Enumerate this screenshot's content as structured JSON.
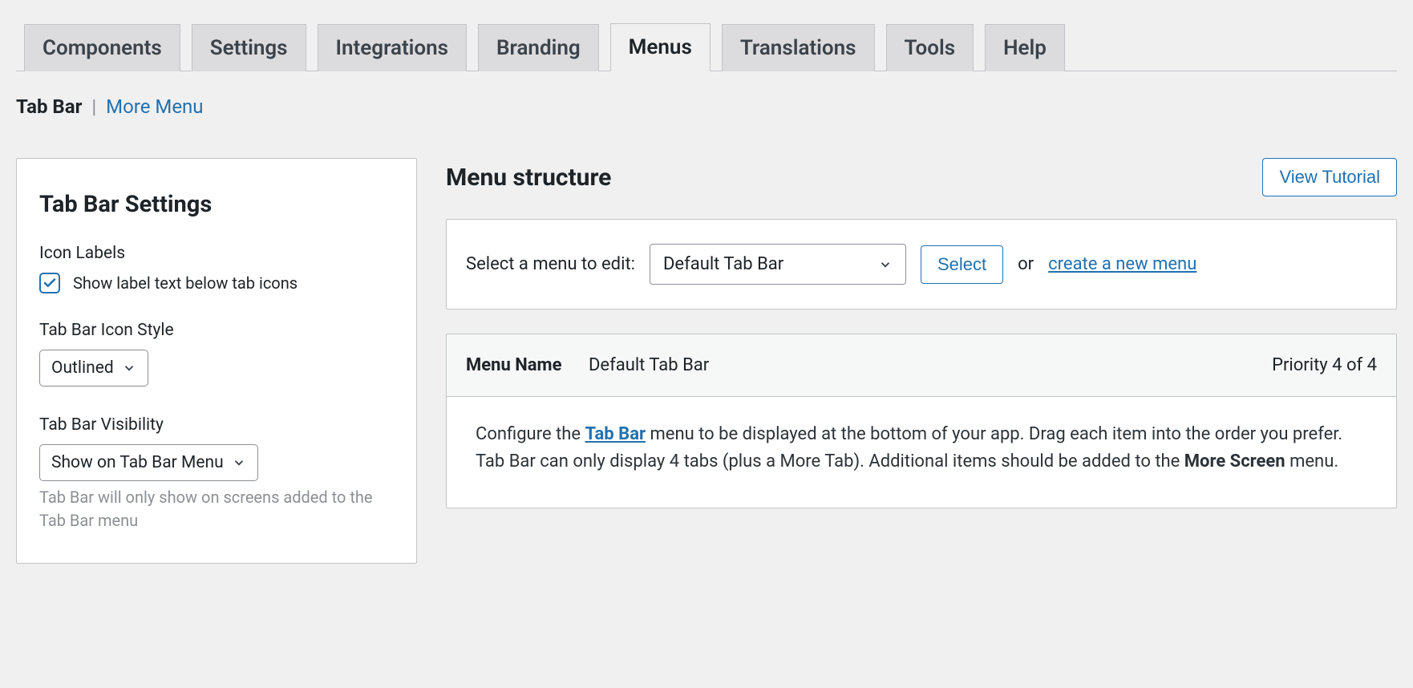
{
  "tabs": {
    "items": [
      {
        "label": "Components",
        "active": false
      },
      {
        "label": "Settings",
        "active": false
      },
      {
        "label": "Integrations",
        "active": false
      },
      {
        "label": "Branding",
        "active": false
      },
      {
        "label": "Menus",
        "active": true
      },
      {
        "label": "Translations",
        "active": false
      },
      {
        "label": "Tools",
        "active": false
      },
      {
        "label": "Help",
        "active": false
      }
    ]
  },
  "subnav": {
    "current": "Tab Bar",
    "separator": "|",
    "link": "More Menu"
  },
  "sidebar": {
    "heading": "Tab Bar Settings",
    "icon_labels": {
      "label": "Icon Labels",
      "checkbox_label": "Show label text below tab icons",
      "checked": true
    },
    "icon_style": {
      "label": "Tab Bar Icon Style",
      "value": "Outlined"
    },
    "visibility": {
      "label": "Tab Bar Visibility",
      "value": "Show on Tab Bar Menu",
      "help": "Tab Bar will only show on screens added to the Tab Bar menu"
    }
  },
  "main": {
    "heading": "Menu structure",
    "view_tutorial": "View Tutorial",
    "select_panel": {
      "label": "Select a menu to edit:",
      "value": "Default Tab Bar",
      "select_button": "Select",
      "or_text": "or",
      "create_link": "create a new menu"
    },
    "menu_header": {
      "name_label": "Menu Name",
      "name_value": "Default Tab Bar",
      "priority": "Priority 4 of 4"
    },
    "description": {
      "pre": "Configure the ",
      "link": "Tab Bar",
      "mid": " menu to be displayed at the bottom of your app. Drag each item into the order you prefer. Tab Bar can only display 4 tabs (plus a More Tab). Additional items should be added to the ",
      "bold": "More Screen",
      "post": " menu."
    }
  }
}
